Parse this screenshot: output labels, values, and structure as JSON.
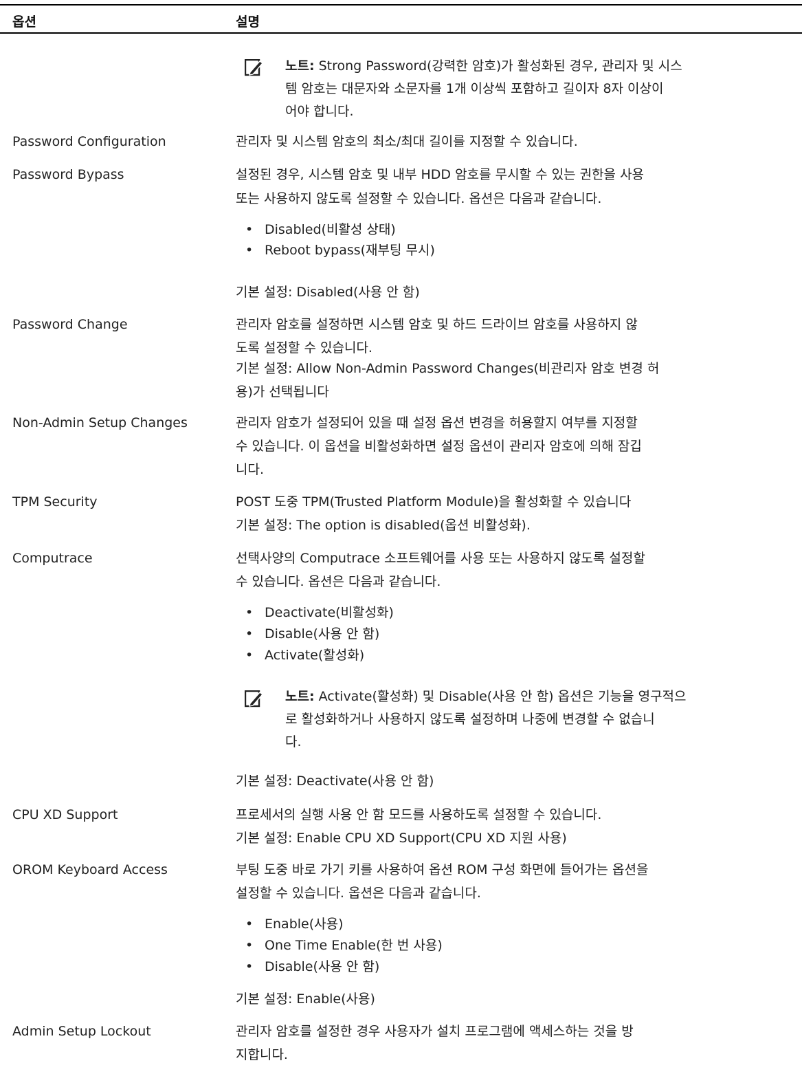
{
  "table": {
    "headers": {
      "option": "옵션",
      "description": "설명"
    },
    "options": [
      "Password Configuration",
      "Password Bypass",
      "Password Change",
      "Non-Admin Setup Changes",
      "TPM Security",
      "Computrace",
      "CPU XD Support",
      "OROM Keyboard Access",
      "Admin Setup Lockout"
    ],
    "desc_lines": [
      "관리자 및 시스템 암호의 최소/최대 길이를 지정할 수 있습니다.",
      "설정된 경우, 시스템 암호 및 내부 HDD 암호를 무시할 수 있는 권한을 사용",
      "또는 사용하지 않도록 설정할 수 있습니다. 옵션은 다음과 같습니다.",
      "기본 설정: Disabled(사용 안 함)",
      "관리자 암호를 설정하면 시스템 암호 및 하드 드라이브 암호를 사용하지 않",
      "도록 설정할 수 있습니다.",
      "기본 설정: Allow Non-Admin Password Changes(비관리자 암호 변경 허",
      "용)가 선택됩니다",
      "관리자 암호가 설정되어 있을 때 설정 옵션 변경을 허용할지 여부를 지정할",
      "수 있습니다. 이 옵션을 비활성화하면 설정 옵션이 관리자 암호에 의해 잠깁",
      "니다.",
      "POST 도중 TPM(Trusted Platform Module)을 활성화할 수 있습니다",
      "기본 설정: The option is disabled(옵션 비활성화).",
      "선택사양의 Computrace 소프트웨어를 사용 또는 사용하지 않도록 설정할",
      "수 있습니다. 옵션은 다음과 같습니다.",
      "기본 설정: Deactivate(사용 안 함)",
      "프로세서의 실행 사용 안 함 모드를 사용하도록 설정할 수 있습니다.",
      "기본 설정: Enable CPU XD Support(CPU XD 지원 사용)",
      "부팅 도중 바로 가기 키를 사용하여 옵션 ROM 구성 화면에 들어가는 옵션을",
      "설정할 수 있습니다. 옵션은 다음과 같습니다.",
      "기본 설정: Enable(사용)",
      "관리자 암호를 설정한 경우 사용자가 설치 프로그램에 액세스하는 것을 방",
      "지합니다."
    ],
    "bullets": [
      "Disabled(비활성 상태)",
      "Reboot bypass(재부팅 무시)",
      "Deactivate(비활성화)",
      "Disable(사용 안 함)",
      "Activate(활성화)",
      "Enable(사용)",
      "One Time Enable(한 번 사용)",
      "Disable(사용 안 함)"
    ],
    "note_label": "노트:",
    "notes": [
      {
        "first": " Strong Password(강력한 암호)가 활성화된 경우, 관리자 및 시스",
        "lines": [
          "템 암호는 대문자와 소문자를 1개 이상씩 포함하고 길이자 8자 이상이",
          "어야 합니다."
        ]
      },
      {
        "first": " Activate(활성화) 및 Disable(사용 안 함) 옵션은 기능을 영구적으",
        "lines": [
          "로 활성화하거나 사용하지 않도록 설정하며 나중에 변경할 수 없습니",
          "다."
        ]
      }
    ]
  },
  "icons": {
    "note": "pencil-note-icon"
  }
}
